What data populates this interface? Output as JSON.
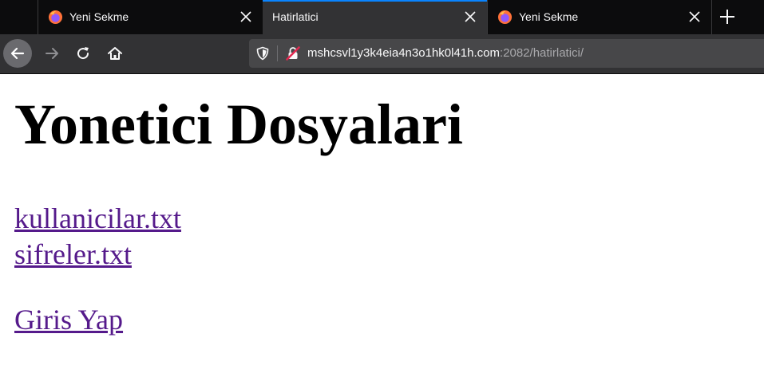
{
  "browser": {
    "tabs": [
      {
        "title": "Yeni Sekme",
        "active": false,
        "icon": "firefox-icon"
      },
      {
        "title": "Hatirlatici",
        "active": true,
        "icon": ""
      },
      {
        "title": "Yeni Sekme",
        "active": false,
        "icon": "firefox-icon"
      }
    ],
    "new_tab_icon": "plus-icon",
    "nav_icons": [
      "back-arrow-icon",
      "forward-arrow-icon",
      "reload-icon",
      "home-icon"
    ],
    "url": {
      "host": "mshcsvl1y3k4eia4n3o1hk0l41h.com",
      "rest": ":2082/hatirlatici/"
    },
    "url_icons": [
      "shield-icon",
      "insecure-lock-icon"
    ],
    "colors": {
      "active_tab_accent": "#0a84ff",
      "tabstrip_bg": "#0c0c0d",
      "toolbar_bg": "#323234",
      "urlbar_bg": "#474749"
    }
  },
  "page": {
    "heading": "Yonetici Dosyalari",
    "links": [
      {
        "label": "kullanicilar.txt"
      },
      {
        "label": "sifreler.txt"
      },
      {
        "label": "Giris Yap"
      }
    ],
    "colors": {
      "link": "#551a8b",
      "heading": "#000000"
    }
  }
}
